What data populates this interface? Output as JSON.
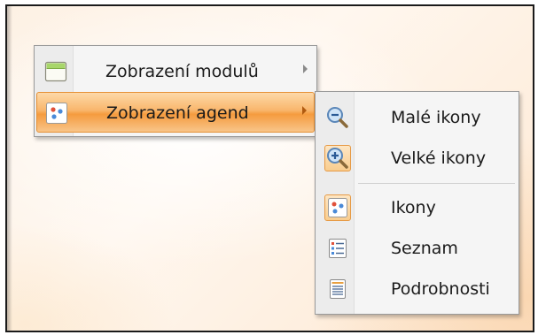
{
  "main_menu": {
    "items": [
      {
        "label": "Zobrazení modulů",
        "icon": "window-icon",
        "has_submenu": true,
        "highlighted": false
      },
      {
        "label": "Zobrazení agend",
        "icon": "agenda-icons-icon",
        "has_submenu": true,
        "highlighted": true
      }
    ]
  },
  "sub_menu": {
    "items": [
      {
        "label": "Malé ikony",
        "icon": "zoom-out-icon",
        "checked": false
      },
      {
        "label": "Velké ikony",
        "icon": "zoom-in-icon",
        "checked": true
      },
      {
        "label": "Ikony",
        "icon": "icons-view-icon",
        "checked": true
      },
      {
        "label": "Seznam",
        "icon": "list-view-icon",
        "checked": false
      },
      {
        "label": "Podrobnosti",
        "icon": "details-view-icon",
        "checked": false
      }
    ]
  },
  "colors": {
    "highlight": "#f9b66c",
    "highlight_border": "#e59035",
    "menu_bg": "#f5f5f5"
  }
}
